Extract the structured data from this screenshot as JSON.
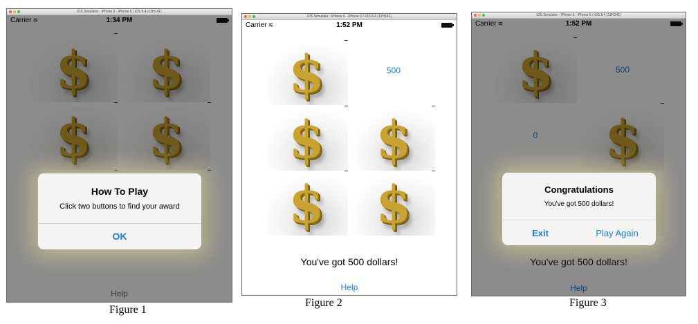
{
  "figures": [
    {
      "caption": "Figure 1",
      "window_title": "iOS Simulator - iPhone 6 - iPhone 6 / iOS 8.4 (12H141)",
      "status": {
        "carrier": "Carrier",
        "time": "1:34 PM"
      },
      "alert": {
        "title": "How To Play",
        "message": "Click two buttons to find your award",
        "buttons": [
          "OK"
        ]
      },
      "help_label": "Help"
    },
    {
      "caption": "Figure 2",
      "window_title": "iOS Simulator - iPhone 6 - iPhone 6 / iOS 8.4 (12H141)",
      "status": {
        "carrier": "Carrier",
        "time": "1:52 PM"
      },
      "revealed_value": "500",
      "result_message": "You've got 500 dollars!",
      "help_label": "Help"
    },
    {
      "caption": "Figure 3",
      "window_title": "iOS Simulator - iPhone 6 - iPhone 6 / iOS 8.4 (12H141)",
      "status": {
        "carrier": "Carrier",
        "time": "1:52 PM"
      },
      "revealed_values": [
        "500",
        "0"
      ],
      "alert": {
        "title": "Congratulations",
        "message": "You've got 500 dollars!",
        "buttons": [
          "Exit",
          "Play Again"
        ]
      },
      "result_message": "You've got 500 dollars!",
      "help_label": "Help"
    }
  ],
  "tile_symbol": "$",
  "colors": {
    "accent_blue": "#1a7de0",
    "gold": "#c9a332",
    "dim_overlay": "rgba(0,0,0,0.45)"
  }
}
